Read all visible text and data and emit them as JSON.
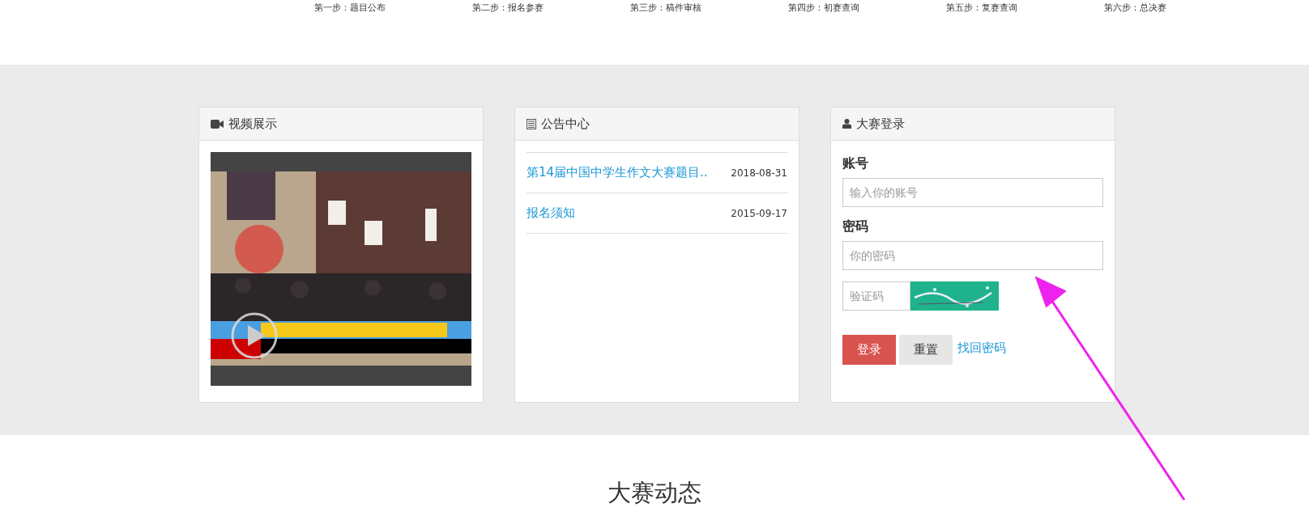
{
  "steps": [
    "第一步：题目公布",
    "第二步：报名参赛",
    "第三步：稿件审核",
    "第四步：初赛查询",
    "第五步：复赛查询",
    "第六步：总决赛"
  ],
  "video_panel": {
    "title": "视频展示"
  },
  "notice_panel": {
    "title": "公告中心",
    "items": [
      {
        "title": "第14届中国中学生作文大赛题目..",
        "date": "2018-08-31"
      },
      {
        "title": "报名须知",
        "date": "2015-09-17"
      }
    ]
  },
  "login_panel": {
    "title": "大赛登录",
    "account_label": "账号",
    "account": {
      "placeholder": "输入你的账号"
    },
    "password_label": "密码",
    "password": {
      "placeholder": "你的密码"
    },
    "captcha": {
      "placeholder": "验证码"
    },
    "buttons": [
      {
        "label": "登录",
        "kind": "primary"
      },
      {
        "label": "重置",
        "kind": "default"
      }
    ],
    "forgot_link": "找回密码"
  },
  "news_heading": "大赛动态"
}
